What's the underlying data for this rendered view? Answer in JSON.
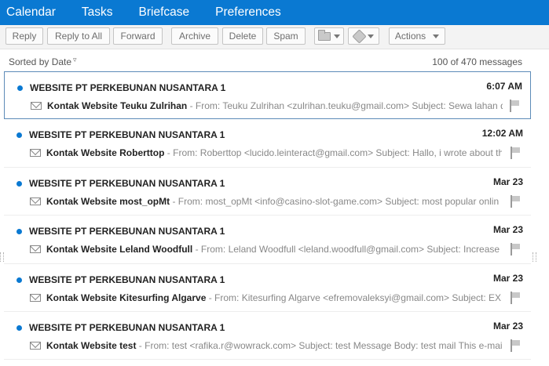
{
  "nav": {
    "items": [
      "Calendar",
      "Tasks",
      "Briefcase",
      "Preferences"
    ]
  },
  "toolbar": {
    "reply": "Reply",
    "reply_all": "Reply to All",
    "forward": "Forward",
    "archive": "Archive",
    "delete": "Delete",
    "spam": "Spam",
    "actions": "Actions"
  },
  "list_header": {
    "sort_label": "Sorted by Date",
    "count": "100 of 470 messages"
  },
  "messages": [
    {
      "sender": "WEBSITE PT PERKEBUNAN NUSANTARA 1",
      "date": "6:07 AM",
      "subject": "Kontak Website Teuku Zulrihan",
      "preview": " - From: Teuku Zulrihan <zulrihan.teuku@gmail.com> Subject: Sewa lahan di"
    },
    {
      "sender": "WEBSITE PT PERKEBUNAN NUSANTARA 1",
      "date": "12:02 AM",
      "subject": "Kontak Website Roberttop",
      "preview": " - From: Roberttop <lucido.leinteract@gmail.com> Subject: Hallo, i wrote about th"
    },
    {
      "sender": "WEBSITE PT PERKEBUNAN NUSANTARA 1",
      "date": "Mar 23",
      "subject": "Kontak Website most_opMt",
      "preview": " - From: most_opMt <info@casino-slot-game.com> Subject: most popular onlin"
    },
    {
      "sender": "WEBSITE PT PERKEBUNAN NUSANTARA 1",
      "date": "Mar 23",
      "subject": "Kontak Website Leland Woodfull",
      "preview": " - From: Leland Woodfull <leland.woodfull@gmail.com> Subject: Increase Y"
    },
    {
      "sender": "WEBSITE PT PERKEBUNAN NUSANTARA 1",
      "date": "Mar 23",
      "subject": "Kontak Website Kitesurfing Algarve",
      "preview": " - From: Kitesurfing Algarve <efremovaleksyi@gmail.com> Subject: EXPI"
    },
    {
      "sender": "WEBSITE PT PERKEBUNAN NUSANTARA 1",
      "date": "Mar 23",
      "subject": "Kontak Website test",
      "preview": " - From: test <rafika.r@wowrack.com> Subject: test Message Body: test mail This e-mail w"
    }
  ],
  "colors": {
    "accent": "#0a79d2",
    "selection_border": "#5d8bb8"
  },
  "icons": [
    "folder-icon",
    "tag-icon",
    "envelope-icon",
    "flag-icon",
    "sort-icon",
    "caret-down-icon"
  ]
}
